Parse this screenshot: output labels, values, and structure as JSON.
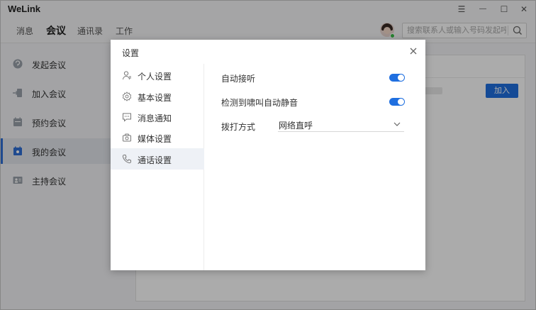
{
  "app": {
    "title": "WeLink"
  },
  "window_controls": {
    "menu": "☰",
    "minimize": "—",
    "maximize": "☐",
    "close": "✕"
  },
  "nav": {
    "tabs": [
      {
        "label": "消息",
        "active": false
      },
      {
        "label": "会议",
        "active": true
      },
      {
        "label": "通讯录",
        "active": false
      },
      {
        "label": "工作",
        "active": false
      }
    ],
    "search_placeholder": "搜索联系人或输入号码发起呼"
  },
  "sidebar": {
    "items": [
      {
        "label": "发起会议",
        "icon": "start-meeting-icon",
        "active": false
      },
      {
        "label": "加入会议",
        "icon": "join-meeting-icon",
        "active": false
      },
      {
        "label": "预约会议",
        "icon": "schedule-meeting-icon",
        "active": false
      },
      {
        "label": "我的会议",
        "icon": "my-meetings-icon",
        "active": true
      },
      {
        "label": "主持会议",
        "icon": "host-meeting-icon",
        "active": false
      }
    ]
  },
  "content": {
    "join_button_label": "加入"
  },
  "dialog": {
    "title": "设置",
    "menu": [
      {
        "label": "个人设置",
        "icon": "user-icon",
        "active": false
      },
      {
        "label": "基本设置",
        "icon": "gear-icon",
        "active": false
      },
      {
        "label": "消息通知",
        "icon": "message-icon",
        "active": false
      },
      {
        "label": "媒体设置",
        "icon": "media-icon",
        "active": false
      },
      {
        "label": "通话设置",
        "icon": "phone-icon",
        "active": true
      }
    ],
    "settings": {
      "auto_answer": {
        "label": "自动接听",
        "enabled": true
      },
      "howl_mute": {
        "label": "检测到啸叫自动静音",
        "enabled": true
      },
      "dial_mode": {
        "label": "拨打方式",
        "value": "网络直呼"
      }
    }
  },
  "colors": {
    "accent": "#1f6fe0",
    "sidebar_active": "#2f6fd6"
  }
}
